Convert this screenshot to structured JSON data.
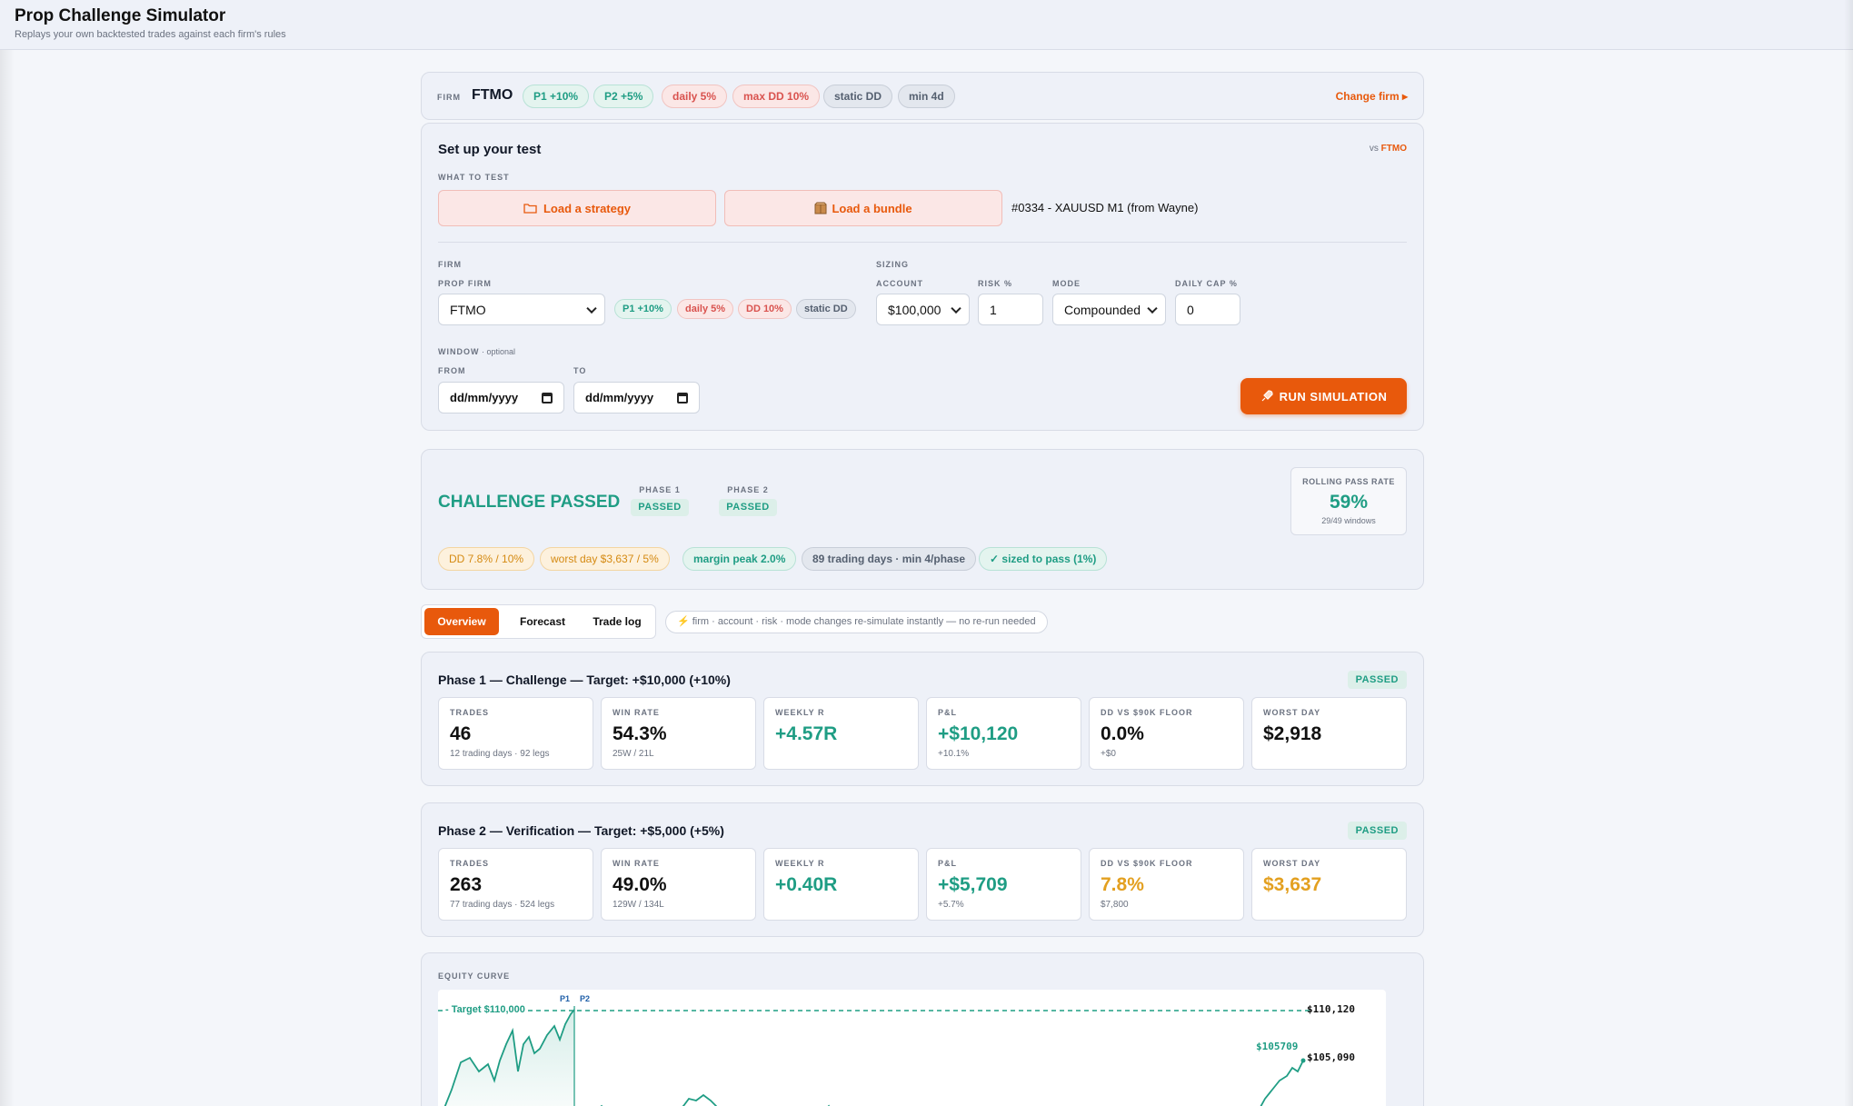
{
  "app": {
    "title": "Prop Challenge Simulator",
    "subtitle": "Replays your own backtested trades against each firm's rules"
  },
  "firm_bar": {
    "label": "FIRM",
    "name": "FTMO",
    "pills": [
      "P1 +10%",
      "P2 +5%",
      "daily 5%",
      "max DD 10%",
      "static DD",
      "min 4d"
    ],
    "change": "Change firm ▸"
  },
  "setup": {
    "title": "Set up your test",
    "vs_prefix": "vs",
    "vs_firm": "FTMO",
    "what_label": "WHAT TO TEST",
    "load_strategy": "Load a strategy",
    "load_bundle": "Load a bundle",
    "loaded": "#0334 - XAUUSD M1 (from Wayne)",
    "firm_section": "FIRM",
    "prop_firm_label": "PROP FIRM",
    "prop_firm_value": "FTMO",
    "firm_pills": [
      "P1 +10%",
      "daily 5%",
      "DD 10%",
      "static DD"
    ],
    "sizing_section": "SIZING",
    "account_label": "ACCOUNT",
    "account_value": "$100,000",
    "risk_label": "RISK %",
    "risk_value": "1",
    "mode_label": "MODE",
    "mode_value": "Compounded",
    "cap_label": "DAILY CAP %",
    "cap_value": "0",
    "window_label": "WINDOW",
    "window_optional": "· optional",
    "from_label": "FROM",
    "from_placeholder": "dd/mm/yyyy",
    "to_label": "TO",
    "to_placeholder": "dd/mm/yyyy",
    "run": "RUN SIMULATION"
  },
  "result": {
    "headline": "CHALLENGE PASSED",
    "phase1_label": "PHASE 1",
    "phase1_status": "PASSED",
    "phase2_label": "PHASE 2",
    "phase2_status": "PASSED",
    "rolling_label": "ROLLING PASS RATE",
    "rolling_value": "59%",
    "rolling_sub": "29/49 windows",
    "chips": [
      "DD 7.8% / 10%",
      "worst day $3,637 / 5%",
      "margin peak 2.0%",
      "89 trading days · min 4/phase",
      "✓ sized to pass (1%)"
    ]
  },
  "tabs": {
    "items": [
      "Overview",
      "Forecast",
      "Trade log"
    ],
    "active": "Overview",
    "note": "⚡ firm · account · risk · mode changes re-simulate instantly — no re-run needed"
  },
  "phase1": {
    "title": "Phase 1 — Challenge — Target: +$10,000 (+10%)",
    "badge": "PASSED",
    "stats": [
      {
        "k": "TRADES",
        "v": "46",
        "s": "12 trading days · 92 legs"
      },
      {
        "k": "WIN RATE",
        "v": "54.3%",
        "s": "25W / 21L"
      },
      {
        "k": "WEEKLY R",
        "v": "+4.57R",
        "s": ""
      },
      {
        "k": "P&L",
        "v": "+$10,120",
        "s": "+10.1%"
      },
      {
        "k": "DD VS $90K FLOOR",
        "v": "0.0%",
        "s": "+$0"
      },
      {
        "k": "WORST DAY",
        "v": "$2,918",
        "s": ""
      }
    ]
  },
  "phase2": {
    "title": "Phase 2 — Verification — Target: +$5,000 (+5%)",
    "badge": "PASSED",
    "stats": [
      {
        "k": "TRADES",
        "v": "263",
        "s": "77 trading days · 524 legs"
      },
      {
        "k": "WIN RATE",
        "v": "49.0%",
        "s": "129W / 134L"
      },
      {
        "k": "WEEKLY R",
        "v": "+0.40R",
        "s": ""
      },
      {
        "k": "P&L",
        "v": "+$5,709",
        "s": "+5.7%"
      },
      {
        "k": "DD VS $90K FLOOR",
        "v": "7.8%",
        "s": "$7,800"
      },
      {
        "k": "WORST DAY",
        "v": "$3,637",
        "s": ""
      }
    ]
  },
  "equity": {
    "label": "EQUITY CURVE",
    "target": "- Target $110,000",
    "p1": "P1",
    "p2": "P2",
    "y_top": "$110,120",
    "y_mid": "$105,090",
    "end_value": "$105709"
  },
  "colors": {
    "accent": "#e8590c",
    "green": "#1f9d84",
    "red": "#d9534f",
    "amber": "#e3a020"
  }
}
